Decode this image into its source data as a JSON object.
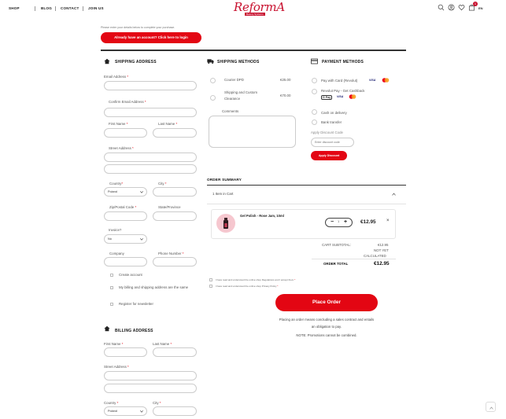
{
  "nav": {
    "items": [
      "SHOP",
      "BLOG",
      "CONTACT",
      "JOIN US"
    ],
    "logo": "ReformA",
    "logo_tagline": "Beauty Systems",
    "cart_count": "1",
    "lang": "EN"
  },
  "intro": {
    "note": "Please enter your details below to complete your purchase.",
    "login_button": "Already have an account? Click here to login"
  },
  "shipping_address": {
    "title": "SHIPPING ADDRESS",
    "email_label": "Email Address",
    "confirm_email_label": "Confirm Email Address",
    "first_name_label": "First Name",
    "last_name_label": "Last Name",
    "street_label": "Street Address",
    "country_label": "Country",
    "country_value": "Poland",
    "city_label": "City",
    "zip_label": "Zip/Postal Code",
    "state_label": "State/Province",
    "invoice_label": "Invoice?",
    "invoice_value": "No",
    "company_label": "Company",
    "phone_label": "Phone Number",
    "create_account": "Create account",
    "same_address": "My billing and shipping address are the same",
    "newsletter": "Register for newsletter",
    "required_mark": "*"
  },
  "billing_address": {
    "title": "BILLING ADDRESS",
    "first_name_label": "First Name",
    "last_name_label": "Last Name",
    "street_label": "Street Address",
    "country_label": "Country",
    "country_value": "Poland",
    "city_label": "City"
  },
  "shipping_methods": {
    "title": "SHIPPING METHODS",
    "options": [
      {
        "name": "Courier DPD",
        "price": "€25.00"
      },
      {
        "name": "Shipping and Custom Clearance",
        "price": "€70.00"
      }
    ],
    "comments_label": "Comments"
  },
  "payment_methods": {
    "title": "PAYMENT METHODS",
    "options": [
      "Pay with Card (Revolut)",
      "Revolut Pay - Get Cashback",
      "Cash on delivery",
      "Bank transfer"
    ],
    "visa": "VISA",
    "gpay": "G Pay",
    "discount_label": "Apply Discount Code",
    "discount_placeholder": "Enter discount code",
    "discount_button": "Apply Discount"
  },
  "order_summary": {
    "title": "ORDER SUMMARY",
    "items_in_cart": "1 Item in Cart",
    "item_name": "Gel Polish - Rose Jam, 10ml",
    "qty": "1",
    "item_price": "€12.95",
    "subtotal_label": "CART SUBTOTAL:",
    "subtotal_value": "€12.95",
    "shipping_value_1": "NOT YET",
    "shipping_value_2": "CALCULATED",
    "total_label": "ORDER TOTAL",
    "total_value": "€12.95"
  },
  "agreements": {
    "regulations": "I have read and understood the online shop Regulations and I accept them",
    "privacy": "I have read and understood the online shop Privacy Policy"
  },
  "place_order": {
    "button": "Place Order",
    "note_1": "Placing an order means concluding a sales contract and entails",
    "note_2": "an obligation to pay.",
    "note_3": "NOTE: Promotions cannot be combined."
  },
  "colors": {
    "brand_red": "#e30613",
    "logo_red": "#c8102e"
  }
}
